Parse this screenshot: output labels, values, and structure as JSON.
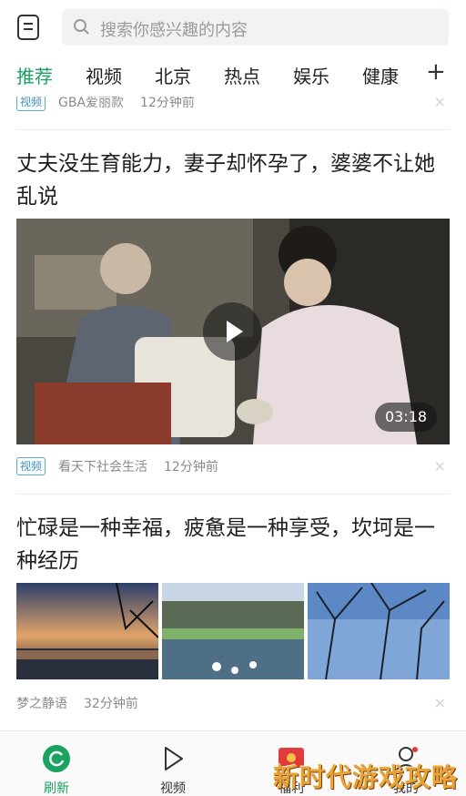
{
  "header": {
    "search_placeholder": "搜索你感兴趣的内容"
  },
  "tabs": [
    {
      "label": "推荐",
      "active": true
    },
    {
      "label": "视频",
      "active": false
    },
    {
      "label": "北京",
      "active": false
    },
    {
      "label": "热点",
      "active": false
    },
    {
      "label": "娱乐",
      "active": false
    },
    {
      "label": "健康",
      "active": false
    }
  ],
  "tab_add_label": "+",
  "feed": {
    "partial_item": {
      "tag": "视频",
      "source": "GBA爱丽款",
      "time": "12分钟前"
    },
    "video_item": {
      "title": "丈夫没生育能力，妻子却怀孕了，婆婆不让她乱说",
      "duration": "03:18",
      "tag": "视频",
      "source": "看天下社会生活",
      "time": "12分钟前"
    },
    "image_item": {
      "title": "忙碌是一种幸福，疲惫是一种享受，坎坷是一种经历",
      "source": "梦之静语",
      "time": "32分钟前"
    },
    "close_glyph": "×"
  },
  "bottom_nav": [
    {
      "label": "刷新",
      "icon": "refresh-icon",
      "active": true
    },
    {
      "label": "视频",
      "icon": "play-outline-icon",
      "active": false
    },
    {
      "label": "福利",
      "icon": "red-envelope-icon",
      "active": false
    },
    {
      "label": "我的",
      "icon": "user-icon",
      "active": false
    }
  ],
  "watermark": "新时代游戏攻略",
  "colors": {
    "accent": "#1aa260",
    "tag_border": "#5aa7cf",
    "meta_text": "#8a8a8a"
  }
}
